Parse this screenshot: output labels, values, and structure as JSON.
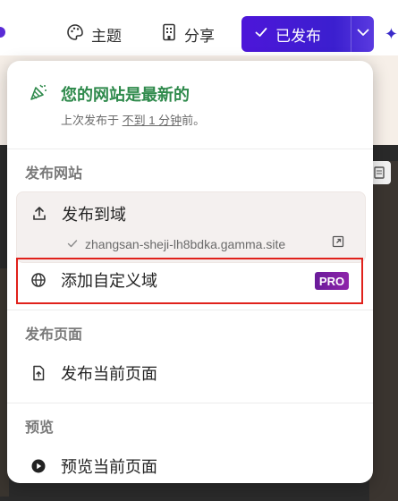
{
  "toolbar": {
    "theme_label": "主题",
    "share_label": "分享",
    "published_label": "已发布"
  },
  "status": {
    "title": "您的网站是最新的",
    "sub_prefix": "上次发布于 ",
    "sub_link": "不到 1 分钟",
    "sub_suffix": "前。"
  },
  "sections": {
    "publish_site": "发布网站",
    "publish_page": "发布页面",
    "preview": "预览"
  },
  "items": {
    "publish_to_domain": "发布到域",
    "domain_url": "zhangsan-sheji-lh8bdka.gamma.site",
    "custom_domain": "添加自定义域",
    "pro_badge": "PRO",
    "publish_current_page": "发布当前页面",
    "preview_current_page": "预览当前页面"
  },
  "colors": {
    "accent": "#4d16d9",
    "success": "#2f8a4c",
    "highlight_border": "#e0211b",
    "pro_badge": "#7b1fa2"
  }
}
